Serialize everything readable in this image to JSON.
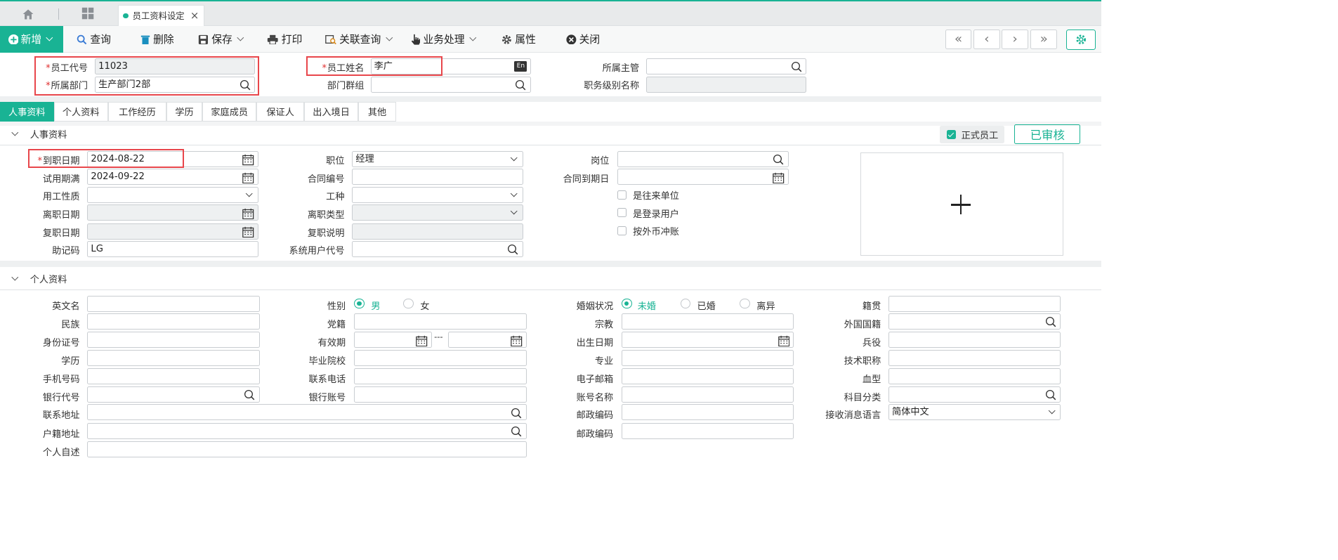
{
  "tab": {
    "title": "员工资料设定"
  },
  "toolbar": {
    "new": "新增",
    "query": "查询",
    "delete": "删除",
    "save": "保存",
    "print": "打印",
    "related_query": "关联查询",
    "business": "业务处理",
    "properties": "属性",
    "close": "关闭"
  },
  "header": {
    "emp_code_label": "员工代号",
    "emp_code": "11023",
    "emp_name_label": "员工姓名",
    "emp_name": "李广",
    "supervisor_label": "所属主管",
    "supervisor": "",
    "dept_label": "所属部门",
    "dept": "生产部门2部",
    "dept_group_label": "部门群组",
    "dept_group": "",
    "job_level_label": "职务级别名称",
    "job_level": ""
  },
  "subtabs": [
    "人事资料",
    "个人资料",
    "工作经历",
    "学历",
    "家庭成员",
    "保证人",
    "出入境日",
    "其他"
  ],
  "hr": {
    "section_title": "人事资料",
    "formal_label": "正式员工",
    "approved_label": "已审核",
    "hire_date_label": "到职日期",
    "hire_date": "2024-08-22",
    "probation_end_label": "试用期满",
    "probation_end": "2024-09-22",
    "employment_type_label": "用工性质",
    "employment_type": "",
    "leave_date_label": "离职日期",
    "leave_date": "",
    "rehire_date_label": "复职日期",
    "rehire_date": "",
    "mnemonic_label": "助记码",
    "mnemonic": "LG",
    "position_label": "职位",
    "position": "经理",
    "contract_no_label": "合同编号",
    "contract_no": "",
    "work_type_label": "工种",
    "work_type": "",
    "leave_type_label": "离职类型",
    "leave_type": "",
    "rehire_note_label": "复职说明",
    "rehire_note": "",
    "sys_user_label": "系统用户代号",
    "sys_user": "",
    "post_label": "岗位",
    "post": "",
    "contract_end_label": "合同到期日",
    "contract_end": "",
    "check1": "是往来单位",
    "check2": "是登录用户",
    "check3": "按外币冲账"
  },
  "personal": {
    "section_title": "个人资料",
    "english_name": "英文名",
    "ethnicity": "民族",
    "id_no": "身份证号",
    "education": "学历",
    "mobile": "手机号码",
    "bank_code": "银行代号",
    "address": "联系地址",
    "household_addr": "户籍地址",
    "self_desc": "个人自述",
    "gender": "性别",
    "male": "男",
    "female": "女",
    "party": "党籍",
    "valid_period": "有效期",
    "valid_sep": "---",
    "school": "毕业院校",
    "phone": "联系电话",
    "bank_account": "银行账号",
    "marital": "婚姻状况",
    "single": "未婚",
    "married": "已婚",
    "divorced": "离异",
    "religion": "宗教",
    "birth_date": "出生日期",
    "major": "专业",
    "email": "电子邮箱",
    "account_name": "账号名称",
    "postcode1": "邮政编码",
    "postcode2": "邮政编码",
    "native_place": "籍贯",
    "nationality": "外国国籍",
    "military": "兵役",
    "tech_title": "技术职称",
    "blood": "血型",
    "subject_cat": "科目分类",
    "msg_lang_label": "接收消息语言",
    "msg_lang": "简体中文"
  }
}
